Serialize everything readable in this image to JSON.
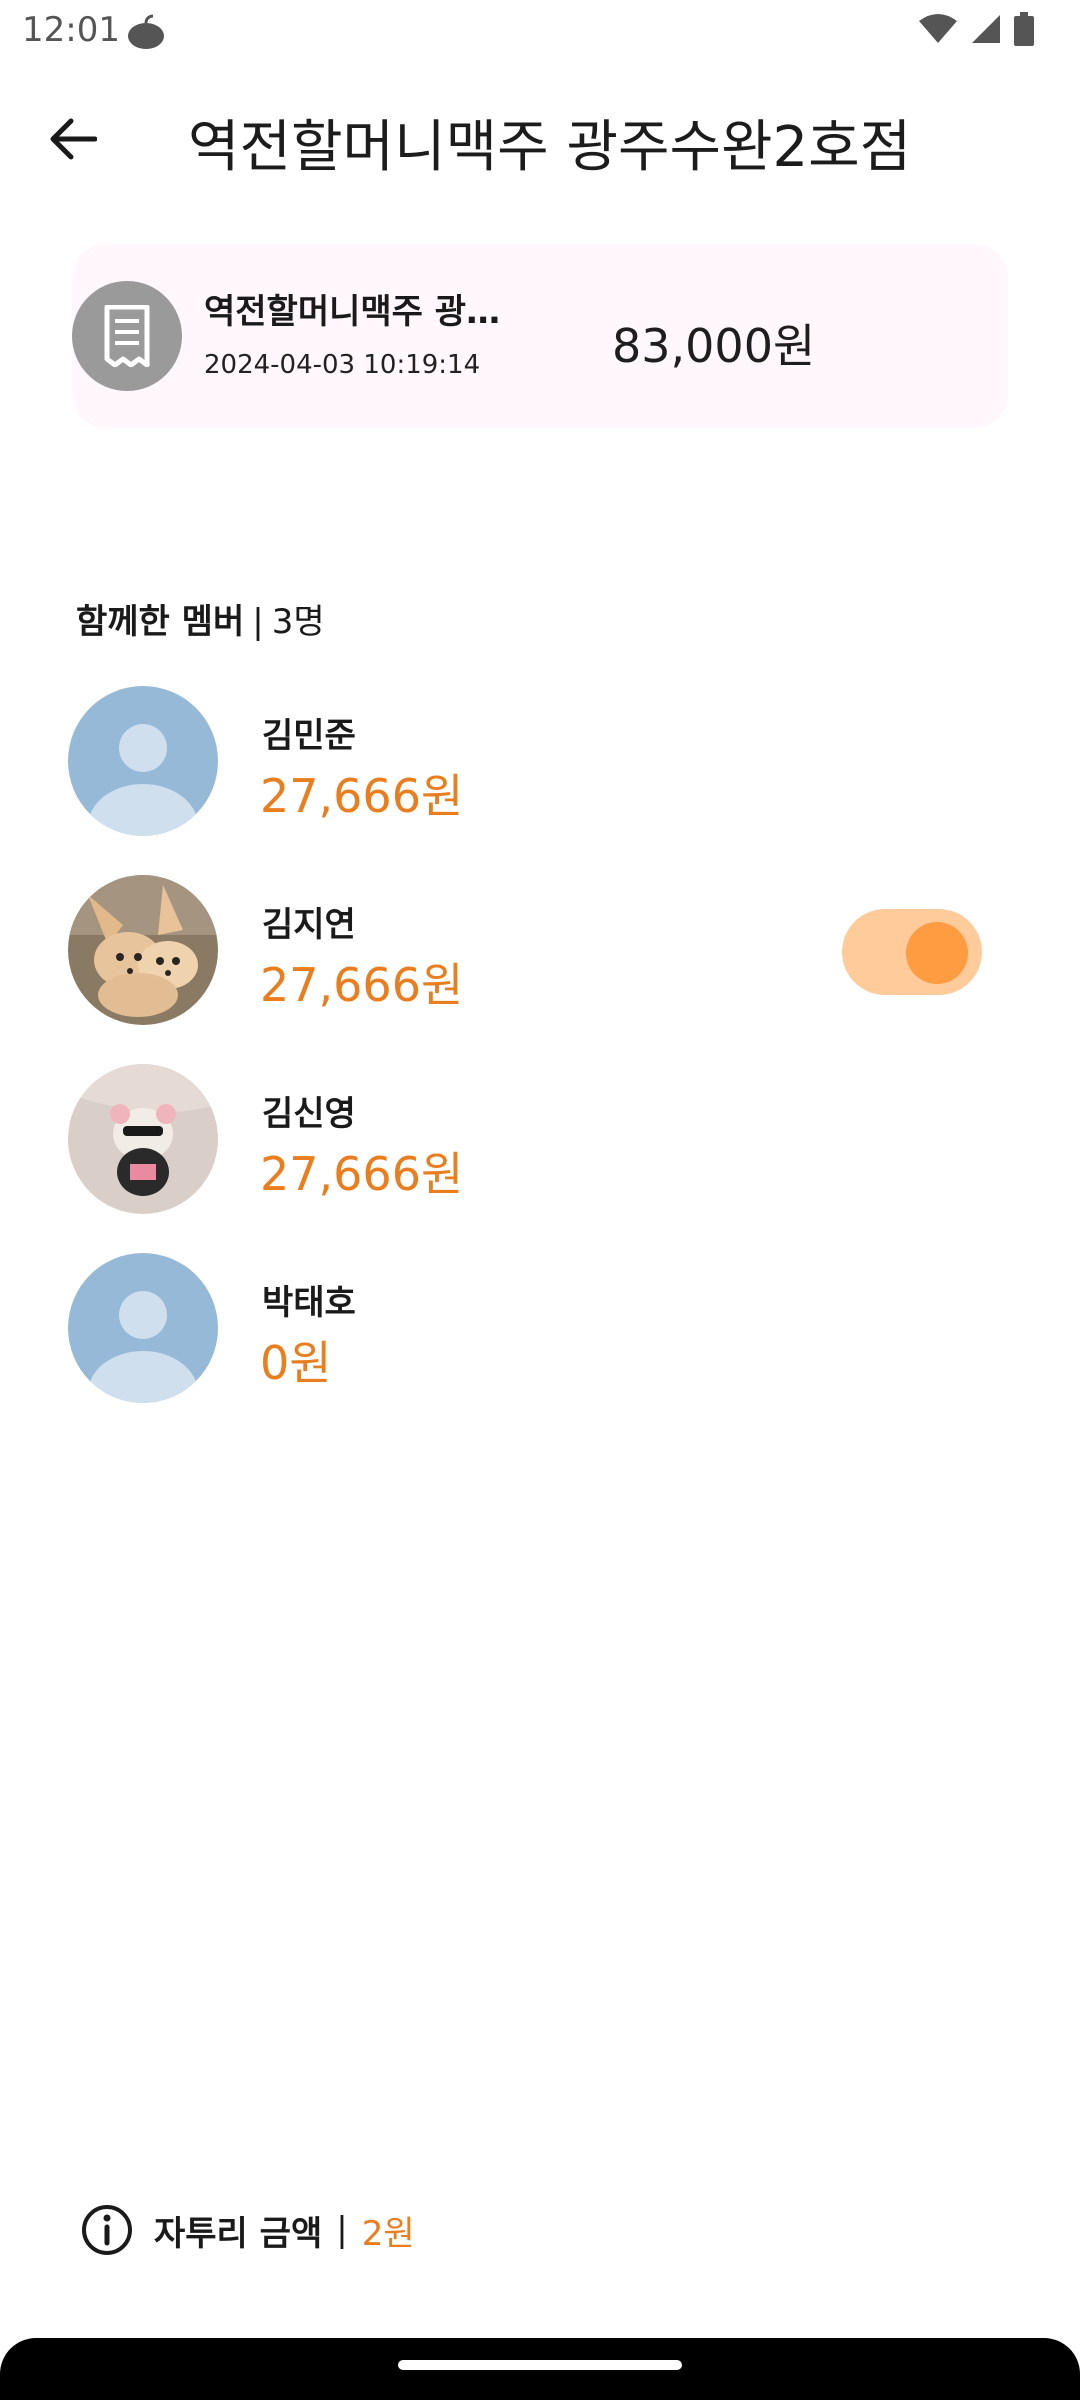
{
  "status_bar": {
    "time": "12:01"
  },
  "app_bar": {
    "title": "역전할머니맥주 광주수완2호점"
  },
  "receipt": {
    "store_name": "역전할머니맥주 광…",
    "datetime": "2024-04-03 10:19:14",
    "amount": "83,000원"
  },
  "members_header": {
    "label": "함께한 멤버",
    "separator": "|",
    "count": "3명"
  },
  "members": [
    {
      "name": "김민준",
      "amount": "27,666원",
      "avatar": "default-avatar",
      "toggle": false
    },
    {
      "name": "김지연",
      "amount": "27,666원",
      "avatar": "fennec-fox-photo",
      "toggle": true
    },
    {
      "name": "김신영",
      "amount": "27,666원",
      "avatar": "plush-bear-photo",
      "toggle": false
    },
    {
      "name": "박태호",
      "amount": "0원",
      "avatar": "default-avatar",
      "toggle": false
    }
  ],
  "leftover": {
    "label": "자투리 금액",
    "separator": "|",
    "value": "2원"
  },
  "colors": {
    "accent": "#ea7d1e",
    "toggle_track": "#ffcb9b",
    "toggle_knob": "#ff9b40",
    "card_bg": "#fff7fb"
  }
}
